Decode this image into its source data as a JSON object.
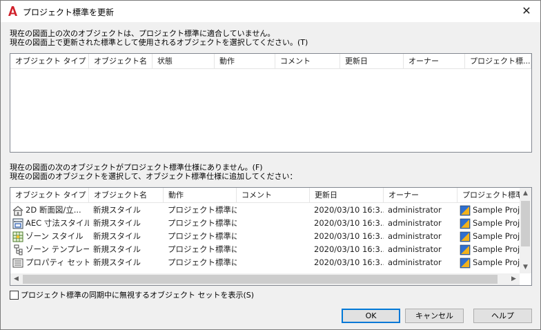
{
  "window": {
    "title": "プロジェクト標準を更新",
    "close_glyph": "✕"
  },
  "upper": {
    "message_line1": "現在の図面上の次のオブジェクトは、プロジェクト標準に適合していません。",
    "message_line2": "現在の図面上で更新された標準として使用されるオブジェクトを選択してください。(T)",
    "columns": [
      "オブジェクト タイプ",
      "オブジェクト名",
      "状態",
      "動作",
      "コメント",
      "更新日",
      "オーナー",
      "プロジェクト標..."
    ],
    "rows": []
  },
  "lower": {
    "message_line1": "現在の図面の次のオブジェクトがプロジェクト標準仕様にありません。(F)",
    "message_line2": "現在の図面のオブジェクトを選択して、オブジェクト標準仕様に追加してください：",
    "columns": [
      "オブジェクト タイプ",
      "オブジェクト名",
      "動作",
      "コメント",
      "更新日",
      "オーナー",
      "プロジェクト標準..."
    ],
    "rows": [
      {
        "icon": "house-section-icon",
        "type": "2D 断面図/立...",
        "name": "新規スタイル",
        "action": "プロジェクト標準に...",
        "comment": "",
        "date": "2020/03/10 16:3...",
        "owner": "administrator",
        "project": "Sample Proje"
      },
      {
        "icon": "dimension-style-icon",
        "type": "AEC 寸法スタイル",
        "name": "新規スタイル",
        "action": "プロジェクト標準に...",
        "comment": "",
        "date": "2020/03/10 16:3...",
        "owner": "administrator",
        "project": "Sample Proje"
      },
      {
        "icon": "zone-style-icon",
        "type": "ゾーン スタイル",
        "name": "新規スタイル",
        "action": "プロジェクト標準に...",
        "comment": "",
        "date": "2020/03/10 16:3...",
        "owner": "administrator",
        "project": "Sample Proje"
      },
      {
        "icon": "zone-template-icon",
        "type": "ゾーン テンプレート",
        "name": "新規スタイル",
        "action": "プロジェクト標準に...",
        "comment": "",
        "date": "2020/03/10 16:3...",
        "owner": "administrator",
        "project": "Sample Proje"
      },
      {
        "icon": "property-set-icon",
        "type": "プロパティ セット...",
        "name": "新規スタイル",
        "action": "プロジェクト標準に...",
        "comment": "",
        "date": "2020/03/10 16:3...",
        "owner": "administrator",
        "project": "Sample Proje"
      }
    ]
  },
  "show_ignored": {
    "checked": false,
    "label": "プロジェクト標準の同期中に無視するオブジェクト セットを表示(S)"
  },
  "buttons": {
    "ok": "OK",
    "cancel": "キャンセル",
    "help": "ヘルプ"
  },
  "colors": {
    "app_icon_red": "#d0202a",
    "selected_button_border": "#0078d7"
  }
}
